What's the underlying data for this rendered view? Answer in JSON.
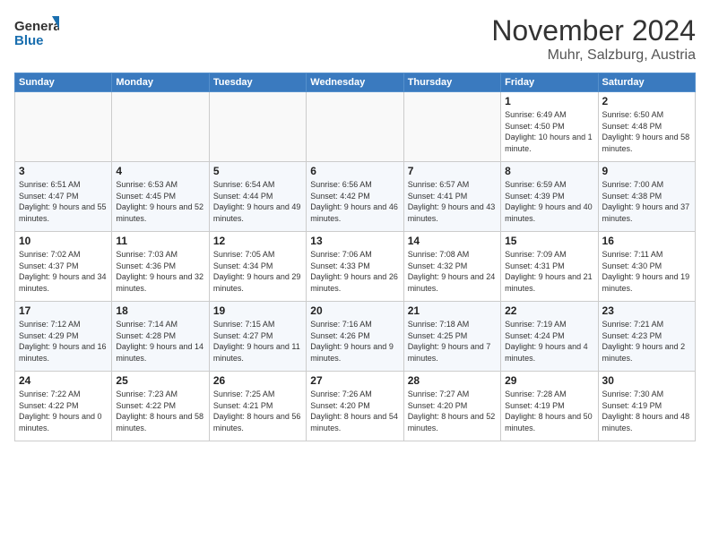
{
  "logo": {
    "line1": "General",
    "line2": "Blue"
  },
  "title": "November 2024",
  "subtitle": "Muhr, Salzburg, Austria",
  "weekdays": [
    "Sunday",
    "Monday",
    "Tuesday",
    "Wednesday",
    "Thursday",
    "Friday",
    "Saturday"
  ],
  "weeks": [
    [
      {
        "day": "",
        "info": ""
      },
      {
        "day": "",
        "info": ""
      },
      {
        "day": "",
        "info": ""
      },
      {
        "day": "",
        "info": ""
      },
      {
        "day": "",
        "info": ""
      },
      {
        "day": "1",
        "info": "Sunrise: 6:49 AM\nSunset: 4:50 PM\nDaylight: 10 hours and 1 minute."
      },
      {
        "day": "2",
        "info": "Sunrise: 6:50 AM\nSunset: 4:48 PM\nDaylight: 9 hours and 58 minutes."
      }
    ],
    [
      {
        "day": "3",
        "info": "Sunrise: 6:51 AM\nSunset: 4:47 PM\nDaylight: 9 hours and 55 minutes."
      },
      {
        "day": "4",
        "info": "Sunrise: 6:53 AM\nSunset: 4:45 PM\nDaylight: 9 hours and 52 minutes."
      },
      {
        "day": "5",
        "info": "Sunrise: 6:54 AM\nSunset: 4:44 PM\nDaylight: 9 hours and 49 minutes."
      },
      {
        "day": "6",
        "info": "Sunrise: 6:56 AM\nSunset: 4:42 PM\nDaylight: 9 hours and 46 minutes."
      },
      {
        "day": "7",
        "info": "Sunrise: 6:57 AM\nSunset: 4:41 PM\nDaylight: 9 hours and 43 minutes."
      },
      {
        "day": "8",
        "info": "Sunrise: 6:59 AM\nSunset: 4:39 PM\nDaylight: 9 hours and 40 minutes."
      },
      {
        "day": "9",
        "info": "Sunrise: 7:00 AM\nSunset: 4:38 PM\nDaylight: 9 hours and 37 minutes."
      }
    ],
    [
      {
        "day": "10",
        "info": "Sunrise: 7:02 AM\nSunset: 4:37 PM\nDaylight: 9 hours and 34 minutes."
      },
      {
        "day": "11",
        "info": "Sunrise: 7:03 AM\nSunset: 4:36 PM\nDaylight: 9 hours and 32 minutes."
      },
      {
        "day": "12",
        "info": "Sunrise: 7:05 AM\nSunset: 4:34 PM\nDaylight: 9 hours and 29 minutes."
      },
      {
        "day": "13",
        "info": "Sunrise: 7:06 AM\nSunset: 4:33 PM\nDaylight: 9 hours and 26 minutes."
      },
      {
        "day": "14",
        "info": "Sunrise: 7:08 AM\nSunset: 4:32 PM\nDaylight: 9 hours and 24 minutes."
      },
      {
        "day": "15",
        "info": "Sunrise: 7:09 AM\nSunset: 4:31 PM\nDaylight: 9 hours and 21 minutes."
      },
      {
        "day": "16",
        "info": "Sunrise: 7:11 AM\nSunset: 4:30 PM\nDaylight: 9 hours and 19 minutes."
      }
    ],
    [
      {
        "day": "17",
        "info": "Sunrise: 7:12 AM\nSunset: 4:29 PM\nDaylight: 9 hours and 16 minutes."
      },
      {
        "day": "18",
        "info": "Sunrise: 7:14 AM\nSunset: 4:28 PM\nDaylight: 9 hours and 14 minutes."
      },
      {
        "day": "19",
        "info": "Sunrise: 7:15 AM\nSunset: 4:27 PM\nDaylight: 9 hours and 11 minutes."
      },
      {
        "day": "20",
        "info": "Sunrise: 7:16 AM\nSunset: 4:26 PM\nDaylight: 9 hours and 9 minutes."
      },
      {
        "day": "21",
        "info": "Sunrise: 7:18 AM\nSunset: 4:25 PM\nDaylight: 9 hours and 7 minutes."
      },
      {
        "day": "22",
        "info": "Sunrise: 7:19 AM\nSunset: 4:24 PM\nDaylight: 9 hours and 4 minutes."
      },
      {
        "day": "23",
        "info": "Sunrise: 7:21 AM\nSunset: 4:23 PM\nDaylight: 9 hours and 2 minutes."
      }
    ],
    [
      {
        "day": "24",
        "info": "Sunrise: 7:22 AM\nSunset: 4:22 PM\nDaylight: 9 hours and 0 minutes."
      },
      {
        "day": "25",
        "info": "Sunrise: 7:23 AM\nSunset: 4:22 PM\nDaylight: 8 hours and 58 minutes."
      },
      {
        "day": "26",
        "info": "Sunrise: 7:25 AM\nSunset: 4:21 PM\nDaylight: 8 hours and 56 minutes."
      },
      {
        "day": "27",
        "info": "Sunrise: 7:26 AM\nSunset: 4:20 PM\nDaylight: 8 hours and 54 minutes."
      },
      {
        "day": "28",
        "info": "Sunrise: 7:27 AM\nSunset: 4:20 PM\nDaylight: 8 hours and 52 minutes."
      },
      {
        "day": "29",
        "info": "Sunrise: 7:28 AM\nSunset: 4:19 PM\nDaylight: 8 hours and 50 minutes."
      },
      {
        "day": "30",
        "info": "Sunrise: 7:30 AM\nSunset: 4:19 PM\nDaylight: 8 hours and 48 minutes."
      }
    ]
  ]
}
